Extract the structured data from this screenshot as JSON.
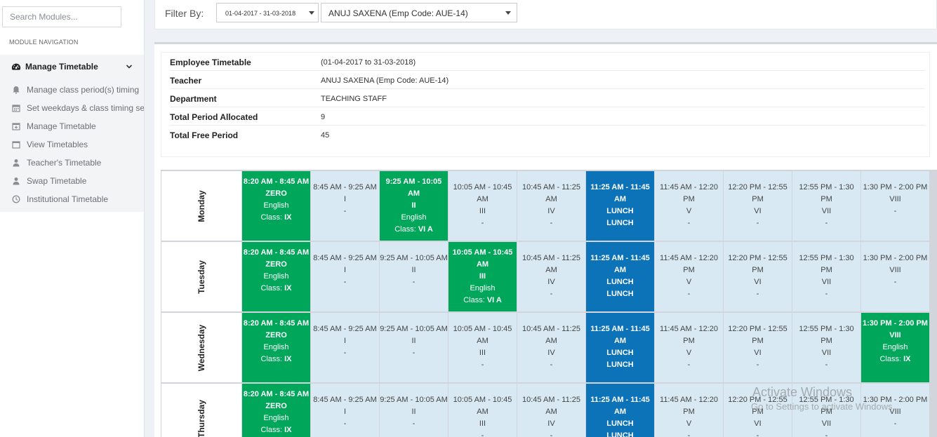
{
  "sidebar": {
    "search_placeholder": "Search Modules...",
    "heading": "MODULE NAVIGATION",
    "main_item": {
      "label": "Manage Timetable",
      "icon": "dashboard-icon"
    },
    "items": [
      {
        "label": "Manage class period(s) timing",
        "icon": "bell-icon"
      },
      {
        "label": "Set weekdays & class timing sets",
        "icon": "calendar-icon"
      },
      {
        "label": "Manage Timetable",
        "icon": "calendar-plus-icon"
      },
      {
        "label": "View Timetables",
        "icon": "calendar-icon"
      },
      {
        "label": "Teacher's Timetable",
        "icon": "user-icon"
      },
      {
        "label": "Swap Timetable",
        "icon": "user-icon"
      },
      {
        "label": "Institutional Timetable",
        "icon": "clock-icon"
      }
    ]
  },
  "filter": {
    "label": "Filter By:",
    "session": "01-04-2017 - 31-03-2018",
    "employee": "ANUJ SAXENA (Emp Code: AUE-14)"
  },
  "info": {
    "rows": [
      {
        "key": "Employee Timetable",
        "value": "(01-04-2017 to 31-03-2018)"
      },
      {
        "key": "Teacher",
        "value": "ANUJ SAXENA (Emp Code: AUE-14)"
      },
      {
        "key": "Department",
        "value": "TEACHING STAFF"
      },
      {
        "key": "Total Period Allocated",
        "value": "9"
      },
      {
        "key": "Total Free Period",
        "value": "45"
      }
    ]
  },
  "timetable": {
    "slots": [
      {
        "time": "8:20 AM - 8:45 AM",
        "period": "ZERO"
      },
      {
        "time": "8:45 AM - 9:25 AM",
        "period": "I"
      },
      {
        "time": "9:25 AM - 10:05 AM",
        "period": "II"
      },
      {
        "time": "10:05 AM - 10:45 AM",
        "period": "III"
      },
      {
        "time": "10:45 AM - 11:25 AM",
        "period": "IV"
      },
      {
        "time": "11:25 AM - 11:45 AM",
        "period": "LUNCH"
      },
      {
        "time": "11:45 AM - 12:20 PM",
        "period": "V"
      },
      {
        "time": "12:20 PM - 12:55 PM",
        "period": "VI"
      },
      {
        "time": "12:55 PM - 1:30 PM",
        "period": "VII"
      },
      {
        "time": "1:30 PM - 2:00 PM",
        "period": "VIII"
      }
    ],
    "days": [
      {
        "name": "Monday",
        "cells": [
          {
            "type": "busy",
            "time": "8:20 AM - 8:45 AM",
            "period": "ZERO",
            "subject": "English",
            "class_label": "Class:",
            "class": "IX"
          },
          {
            "type": "free",
            "time": "8:45 AM - 9:25 AM",
            "period": "I",
            "note": "-"
          },
          {
            "type": "busy",
            "time": "9:25 AM - 10:05 AM",
            "period": "II",
            "subject": "English",
            "class_label": "Class:",
            "class": "VI A"
          },
          {
            "type": "free",
            "time": "10:05 AM - 10:45 AM",
            "period": "III",
            "note": "-"
          },
          {
            "type": "free",
            "time": "10:45 AM - 11:25 AM",
            "period": "IV",
            "note": "-"
          },
          {
            "type": "lunch",
            "time": "11:25 AM - 11:45 AM",
            "period": "LUNCH",
            "note": "LUNCH"
          },
          {
            "type": "free",
            "time": "11:45 AM - 12:20 PM",
            "period": "V",
            "note": "-"
          },
          {
            "type": "free",
            "time": "12:20 PM - 12:55 PM",
            "period": "VI",
            "note": "-"
          },
          {
            "type": "free",
            "time": "12:55 PM - 1:30 PM",
            "period": "VII",
            "note": "-"
          },
          {
            "type": "free",
            "time": "1:30 PM - 2:00 PM",
            "period": "VIII",
            "note": "-"
          }
        ]
      },
      {
        "name": "Tuesday",
        "cells": [
          {
            "type": "busy",
            "time": "8:20 AM - 8:45 AM",
            "period": "ZERO",
            "subject": "English",
            "class_label": "Class:",
            "class": "IX"
          },
          {
            "type": "free",
            "time": "8:45 AM - 9:25 AM",
            "period": "I",
            "note": "-"
          },
          {
            "type": "free",
            "time": "9:25 AM - 10:05 AM",
            "period": "II",
            "note": "-"
          },
          {
            "type": "busy",
            "time": "10:05 AM - 10:45 AM",
            "period": "III",
            "subject": "English",
            "class_label": "Class:",
            "class": "VI A"
          },
          {
            "type": "free",
            "time": "10:45 AM - 11:25 AM",
            "period": "IV",
            "note": "-"
          },
          {
            "type": "lunch",
            "time": "11:25 AM - 11:45 AM",
            "period": "LUNCH",
            "note": "LUNCH"
          },
          {
            "type": "free",
            "time": "11:45 AM - 12:20 PM",
            "period": "V",
            "note": "-"
          },
          {
            "type": "free",
            "time": "12:20 PM - 12:55 PM",
            "period": "VI",
            "note": "-"
          },
          {
            "type": "free",
            "time": "12:55 PM - 1:30 PM",
            "period": "VII",
            "note": "-"
          },
          {
            "type": "free",
            "time": "1:30 PM - 2:00 PM",
            "period": "VIII",
            "note": "-"
          }
        ]
      },
      {
        "name": "Wednesday",
        "cells": [
          {
            "type": "busy",
            "time": "8:20 AM - 8:45 AM",
            "period": "ZERO",
            "subject": "English",
            "class_label": "Class:",
            "class": "IX"
          },
          {
            "type": "free",
            "time": "8:45 AM - 9:25 AM",
            "period": "I",
            "note": "-"
          },
          {
            "type": "free",
            "time": "9:25 AM - 10:05 AM",
            "period": "II",
            "note": "-"
          },
          {
            "type": "free",
            "time": "10:05 AM - 10:45 AM",
            "period": "III",
            "note": "-"
          },
          {
            "type": "free",
            "time": "10:45 AM - 11:25 AM",
            "period": "IV",
            "note": "-"
          },
          {
            "type": "lunch",
            "time": "11:25 AM - 11:45 AM",
            "period": "LUNCH",
            "note": "LUNCH"
          },
          {
            "type": "free",
            "time": "11:45 AM - 12:20 PM",
            "period": "V",
            "note": "-"
          },
          {
            "type": "free",
            "time": "12:20 PM - 12:55 PM",
            "period": "VI",
            "note": "-"
          },
          {
            "type": "free",
            "time": "12:55 PM - 1:30 PM",
            "period": "VII",
            "note": "-"
          },
          {
            "type": "busy",
            "time": "1:30 PM - 2:00 PM",
            "period": "VIII",
            "subject": "English",
            "class_label": "Class:",
            "class": "IX"
          }
        ]
      },
      {
        "name": "Thursday",
        "cells": [
          {
            "type": "busy",
            "time": "8:20 AM - 8:45 AM",
            "period": "ZERO",
            "subject": "English",
            "class_label": "Class:",
            "class": "IX"
          },
          {
            "type": "free",
            "time": "8:45 AM - 9:25 AM",
            "period": "I",
            "note": "-"
          },
          {
            "type": "free",
            "time": "9:25 AM - 10:05 AM",
            "period": "II",
            "note": "-"
          },
          {
            "type": "free",
            "time": "10:05 AM - 10:45 AM",
            "period": "III",
            "note": "-"
          },
          {
            "type": "free",
            "time": "10:45 AM - 11:25 AM",
            "period": "IV",
            "note": "-"
          },
          {
            "type": "lunch",
            "time": "11:25 AM - 11:45 AM",
            "period": "LUNCH",
            "note": "LUNCH"
          },
          {
            "type": "free",
            "time": "11:45 AM - 12:20 PM",
            "period": "V",
            "note": "-"
          },
          {
            "type": "free",
            "time": "12:20 PM - 12:55 PM",
            "period": "VI",
            "note": "-"
          },
          {
            "type": "free",
            "time": "12:55 PM - 1:30 PM",
            "period": "VII",
            "note": "-"
          },
          {
            "type": "free",
            "time": "1:30 PM - 2:00 PM",
            "period": "VIII",
            "note": "-"
          }
        ]
      }
    ]
  },
  "watermark": {
    "title": "Activate Windows",
    "subtitle": "Go to Settings to activate Windows."
  },
  "colors": {
    "busy": "#00a65a",
    "lunch": "#0d73b9",
    "free": "#d8e9f3"
  }
}
